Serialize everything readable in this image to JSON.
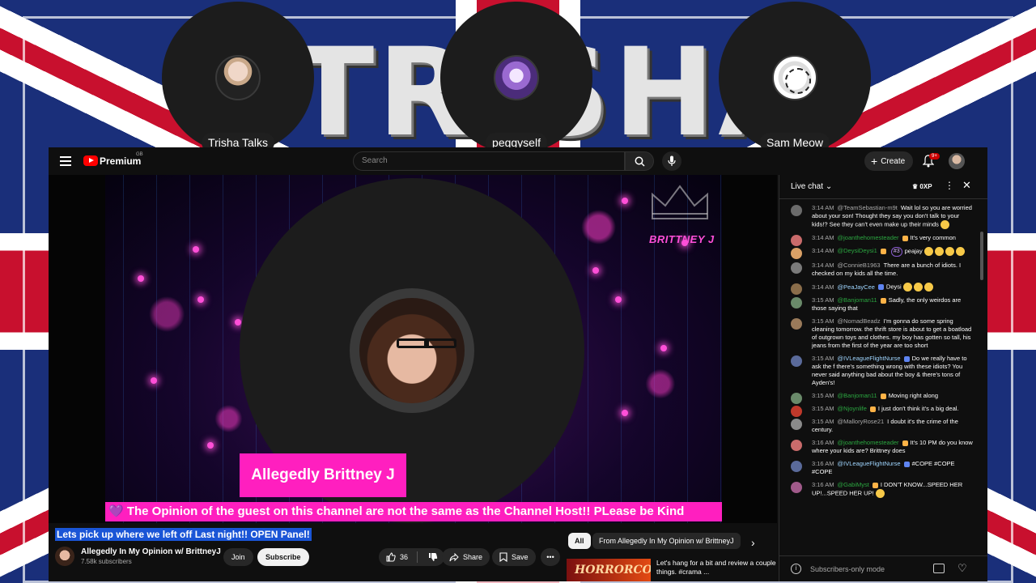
{
  "backdrop": {
    "banner_text": "TRISHA"
  },
  "participants": [
    {
      "name": "Trisha Talks"
    },
    {
      "name": "peggyself"
    },
    {
      "name": "Sam Meow"
    }
  ],
  "topbar": {
    "brand": "Premium",
    "region": "GB",
    "search_placeholder": "Search",
    "create_label": "Create",
    "notification_count": "9+"
  },
  "player": {
    "overlay_brand": "BRITTNEY J",
    "lower_third": "Allegedly Brittney J",
    "ticker": "💜 The Opinion of the guest on this channel are not the same as the Channel Host!! PLease be Kind"
  },
  "video": {
    "title": "Lets pick up where we left off Last night!! OPEN Panel!",
    "channel_name": "Allegedly In My Opinion w/ BrittneyJ",
    "subscribers": "7.58k subscribers",
    "join_label": "Join",
    "subscribe_label": "Subscribe",
    "likes": "36",
    "share_label": "Share",
    "save_label": "Save"
  },
  "recommendations": {
    "chips": [
      "All",
      "From Allegedly In My Opinion w/ BrittneyJ"
    ],
    "item": {
      "thumb_text": "HORRORCOW",
      "title": "Let's hang for a bit and review a couple things. #crama ..."
    }
  },
  "chat": {
    "title": "Live chat",
    "xp": "0XP",
    "footer_text": "Subscribers-only mode",
    "messages": [
      {
        "time": "3:14 AM",
        "user": "@TeamSebastian-m9t",
        "text": "Wait lol so you are worried about your son! Thought they say you don't talk to your kids!? See they can't even make up their minds",
        "av": "#6b6b6b",
        "cls": "",
        "emojis": 1
      },
      {
        "time": "3:14 AM",
        "user": "@joanthehomesteader",
        "text": "It's very common",
        "av": "#c96b6b",
        "cls": "mem",
        "emojis": 0
      },
      {
        "time": "3:14 AM",
        "user": "@DeysiDeysi1",
        "text": "peajay",
        "av": "#d9a066",
        "cls": "mem",
        "emojis": 4,
        "tag": "#3"
      },
      {
        "time": "3:14 AM",
        "user": "@ConnieB1963",
        "text": "There are a bunch of idiots. I checked on my kids all the time.",
        "av": "#7a7a7a",
        "cls": "",
        "emojis": 0
      },
      {
        "time": "3:14 AM",
        "user": "@PeaJayCee",
        "text": "Deysi",
        "av": "#8a6d4a",
        "cls": "mod",
        "emojis": 3
      },
      {
        "time": "3:15 AM",
        "user": "@Banjoman11",
        "text": "Sadly, the only weirdos are those saying that",
        "av": "#6a8a6a",
        "cls": "mem",
        "emojis": 0
      },
      {
        "time": "3:15 AM",
        "user": "@NomadBeadz",
        "text": "I'm gonna do some spring cleaning tomorrow. the thrift store is about to get a boatload of outgrown toys and clothes. my boy has gotten so tall, his jeans from the first of the year are too short",
        "av": "#9a7a5a",
        "cls": "",
        "emojis": 0
      },
      {
        "time": "3:15 AM",
        "user": "@IVLeagueFlightNurse",
        "text": "Do we really have to ask the f there's something wrong with these idiots? You never said anything bad about the boy & there's tons of Ayden's!",
        "av": "#5a6a9a",
        "cls": "mod",
        "emojis": 0
      },
      {
        "time": "3:15 AM",
        "user": "@Banjoman11",
        "text": "Moving right along",
        "av": "#6a8a6a",
        "cls": "mem",
        "emojis": 0
      },
      {
        "time": "3:15 AM",
        "user": "@Njoynlife",
        "text": "I just don't think it's a big deal.",
        "av": "#c0392b",
        "cls": "mem",
        "emojis": 0
      },
      {
        "time": "3:15 AM",
        "user": "@MalloryRose21",
        "text": "I doubt it's the crime of the century.",
        "av": "#8a8a8a",
        "cls": "",
        "emojis": 0
      },
      {
        "time": "3:16 AM",
        "user": "@joanthehomesteader",
        "text": "It's 10 PM do you know where your kids are? Brittney does",
        "av": "#c96b6b",
        "cls": "mem",
        "emojis": 0
      },
      {
        "time": "3:16 AM",
        "user": "@IVLeagueFlightNurse",
        "text": "#COPE #COPE #COPE",
        "av": "#5a6a9a",
        "cls": "mod",
        "emojis": 0
      },
      {
        "time": "3:16 AM",
        "user": "@GabiMyst",
        "text": "I DON'T KNOW...SPEED HER UP!...SPEED HER UP!",
        "av": "#a05a8a",
        "cls": "mem",
        "emojis": 1
      }
    ]
  }
}
